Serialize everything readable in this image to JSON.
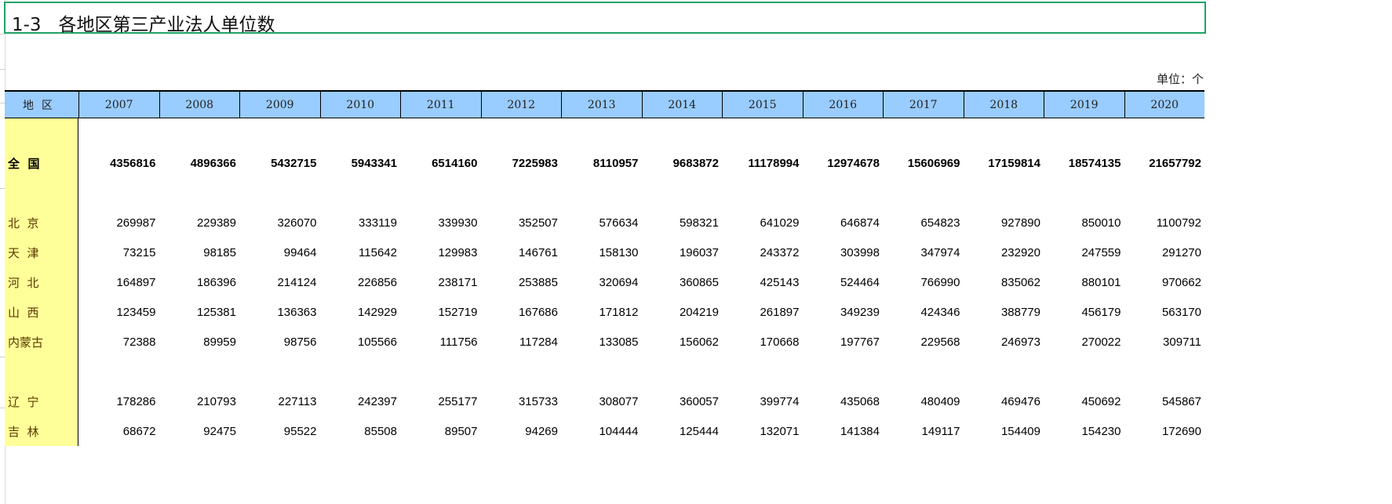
{
  "title": "1-3   各地区第三产业法人单位数",
  "unit_label": "单位：个",
  "table": {
    "region_header": "地区",
    "years": [
      "2007",
      "2008",
      "2009",
      "2010",
      "2011",
      "2012",
      "2013",
      "2014",
      "2015",
      "2016",
      "2017",
      "2018",
      "2019",
      "2020"
    ],
    "rows": [
      {
        "region": "全  国",
        "bold": true,
        "values": [
          "4356816",
          "4896366",
          "5432715",
          "5943341",
          "6514160",
          "7225983",
          "8110957",
          "9683872",
          "11178994",
          "12974678",
          "15606969",
          "17159814",
          "18574135",
          "21657792"
        ]
      },
      {
        "region": "北  京",
        "values": [
          "269987",
          "229389",
          "326070",
          "333119",
          "339930",
          "352507",
          "576634",
          "598321",
          "641029",
          "646874",
          "654823",
          "927890",
          "850010",
          "1100792"
        ]
      },
      {
        "region": "天  津",
        "values": [
          "73215",
          "98185",
          "99464",
          "115642",
          "129983",
          "146761",
          "158130",
          "196037",
          "243372",
          "303998",
          "347974",
          "232920",
          "247559",
          "291270"
        ]
      },
      {
        "region": "河  北",
        "values": [
          "164897",
          "186396",
          "214124",
          "226856",
          "238171",
          "253885",
          "320694",
          "360865",
          "425143",
          "524464",
          "766990",
          "835062",
          "880101",
          "970662"
        ]
      },
      {
        "region": "山  西",
        "values": [
          "123459",
          "125381",
          "136363",
          "142929",
          "152719",
          "167686",
          "171812",
          "204219",
          "261897",
          "349239",
          "424346",
          "388779",
          "456179",
          "563170"
        ]
      },
      {
        "region": "内蒙古",
        "values": [
          "72388",
          "89959",
          "98756",
          "105566",
          "111756",
          "117284",
          "133085",
          "156062",
          "170668",
          "197767",
          "229568",
          "246973",
          "270022",
          "309711"
        ]
      },
      {
        "region": "辽  宁",
        "values": [
          "178286",
          "210793",
          "227113",
          "242397",
          "255177",
          "315733",
          "308077",
          "360057",
          "399774",
          "435068",
          "480409",
          "469476",
          "450692",
          "545867"
        ]
      },
      {
        "region": "吉  林",
        "values": [
          "68672",
          "92475",
          "95522",
          "85508",
          "89507",
          "94269",
          "104444",
          "125444",
          "132071",
          "141384",
          "149117",
          "154409",
          "154230",
          "172690"
        ]
      }
    ]
  }
}
